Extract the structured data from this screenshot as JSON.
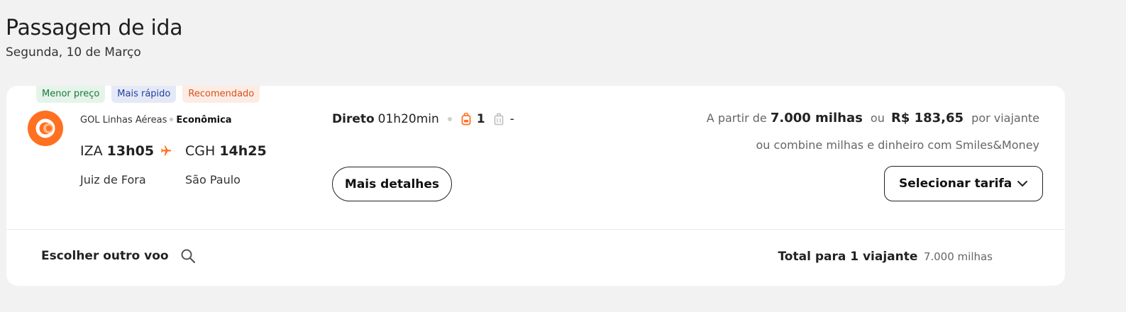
{
  "header": {
    "title": "Passagem de ida",
    "date": "Segunda, 10 de Março"
  },
  "tags": [
    {
      "label": "Menor preço",
      "color": "#1a7a3a"
    },
    {
      "label": "Mais rápido",
      "color": "#23419a"
    },
    {
      "label": "Recomendado",
      "color": "#d4541c"
    }
  ],
  "flight": {
    "airline": "GOL Linhas Aéreas",
    "cabin": "Econômica",
    "logo_icon": "gol-logo-icon",
    "brand_color": "#ff7020",
    "departure": {
      "code": "IZA",
      "time": "13h05",
      "city": "Juiz de Fora"
    },
    "arrival": {
      "code": "CGH",
      "time": "14h25",
      "city": "São Paulo"
    },
    "stops": "Direto",
    "duration": "01h20min",
    "carry_on_count": "1",
    "checked_bag": "-",
    "details_label": "Mais detalhes"
  },
  "pricing": {
    "from_label": "A partir de",
    "miles": "7.000 milhas",
    "or_label": "ou",
    "money": "R$ 183,65",
    "per_traveler": "por viajante",
    "combine_text": "ou combine milhas e dinheiro com Smiles&Money",
    "select_label": "Selecionar tarifa"
  },
  "footer": {
    "other_flight_label": "Escolher outro voo",
    "total_label": "Total para 1 viajante",
    "total_value": "7.000 milhas"
  }
}
